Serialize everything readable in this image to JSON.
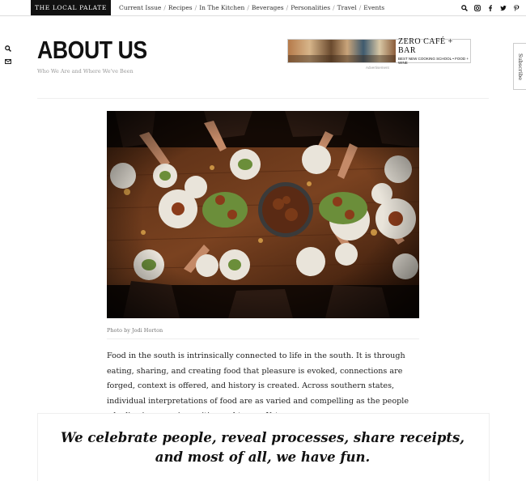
{
  "header": {
    "brand": "THE LOCAL PALATE",
    "nav": [
      "Current Issue",
      "Recipes",
      "In The Kitchen",
      "Beverages",
      "Personalities",
      "Travel",
      "Events"
    ],
    "separator": "/",
    "icons": [
      "search-icon",
      "instagram-icon",
      "facebook-icon",
      "twitter-icon",
      "pinterest-icon"
    ]
  },
  "side_icons": [
    "search-icon",
    "mail-icon"
  ],
  "page": {
    "title": "ABOUT US",
    "subtitle": "Who We Are and Where We've Been"
  },
  "ad": {
    "headline": "ZERO CAFÉ + BAR",
    "tagline": "BEST NEW COOKING SCHOOL • FOOD + WINE",
    "label": "Advertisement"
  },
  "subscribe": "Subscribe",
  "hero": {
    "caption": "Photo by Jodi Horton"
  },
  "body": {
    "paragraph": "Food in the south is intrinsically connected to life in the south. It is through eating, sharing, and creating food that pleasure is evoked, connections are forged, context is offered, and history is created. Across southern states, individual interpretations of food are as varied and compelling as the people who live in our unique cities and towns. Yet"
  },
  "pullquote": "We celebrate people, reveal processes, share receipts, and most of all, we have fun.",
  "colors": {
    "brand_bg": "#111111",
    "text": "#222222",
    "muted": "#999999"
  }
}
